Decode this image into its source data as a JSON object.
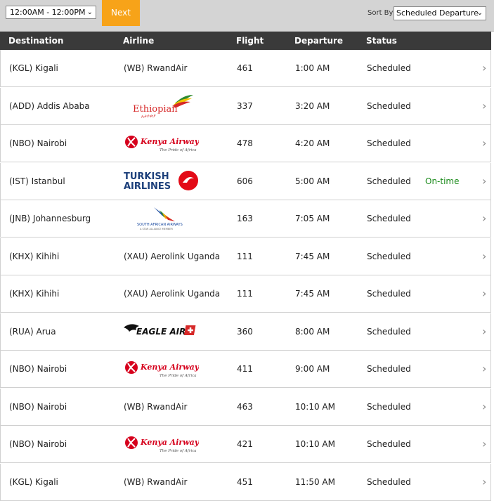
{
  "filters": {
    "time_range": "12:00AM - 12:00PM",
    "next_label": "Next",
    "sort_label": "Sort By",
    "sort_value": "Scheduled Departure"
  },
  "columns": [
    "Destination",
    "Airline",
    "Flight",
    "Departure",
    "Status"
  ],
  "logos": {
    "ethiopian": "Ethiopian",
    "kenya": "Kenya Airways",
    "kenya_tag": "The Pride of Africa",
    "turkish_1": "TURKISH",
    "turkish_2": "AIRLINES",
    "saa": "SOUTH AFRICAN AIRWAYS",
    "saa_tag": "A STAR ALLIANCE MEMBER",
    "eagle": "EAGLE AIR"
  },
  "rows": [
    {
      "destination": "(KGL) Kigali",
      "airline": "(WB) RwandAir",
      "flight": "461",
      "departure": "1:00 AM",
      "status": "Scheduled",
      "note": ""
    },
    {
      "destination": "(ADD) Addis Ababa",
      "airline": "",
      "flight": "337",
      "departure": "3:20 AM",
      "status": "Scheduled",
      "note": ""
    },
    {
      "destination": "(NBO) Nairobi",
      "airline": "",
      "flight": "478",
      "departure": "4:20 AM",
      "status": "Scheduled",
      "note": ""
    },
    {
      "destination": "(IST) Istanbul",
      "airline": "",
      "flight": "606",
      "departure": "5:00 AM",
      "status": "Scheduled",
      "note": "On-time"
    },
    {
      "destination": "(JNB) Johannesburg",
      "airline": "",
      "flight": "163",
      "departure": "7:05 AM",
      "status": "Scheduled",
      "note": ""
    },
    {
      "destination": "(KHX) Kihihi",
      "airline": "(XAU) Aerolink Uganda",
      "flight": "111",
      "departure": "7:45 AM",
      "status": "Scheduled",
      "note": ""
    },
    {
      "destination": "(KHX) Kihihi",
      "airline": "(XAU) Aerolink Uganda",
      "flight": "111",
      "departure": "7:45 AM",
      "status": "Scheduled",
      "note": ""
    },
    {
      "destination": "(RUA) Arua",
      "airline": "",
      "flight": "360",
      "departure": "8:00 AM",
      "status": "Scheduled",
      "note": ""
    },
    {
      "destination": "(NBO) Nairobi",
      "airline": "",
      "flight": "411",
      "departure": "9:00 AM",
      "status": "Scheduled",
      "note": ""
    },
    {
      "destination": "(NBO) Nairobi",
      "airline": "(WB) RwandAir",
      "flight": "463",
      "departure": "10:10 AM",
      "status": "Scheduled",
      "note": ""
    },
    {
      "destination": "(NBO) Nairobi",
      "airline": "",
      "flight": "421",
      "departure": "10:10 AM",
      "status": "Scheduled",
      "note": ""
    },
    {
      "destination": "(KGL) Kigali",
      "airline": "(WB) RwandAir",
      "flight": "451",
      "departure": "11:50 AM",
      "status": "Scheduled",
      "note": ""
    }
  ],
  "row_arrow": "›",
  "select_chevron": "⌄",
  "colors": {
    "accent": "#f7a319",
    "header": "#3a3a3a",
    "ontime": "#1a8a1a"
  }
}
